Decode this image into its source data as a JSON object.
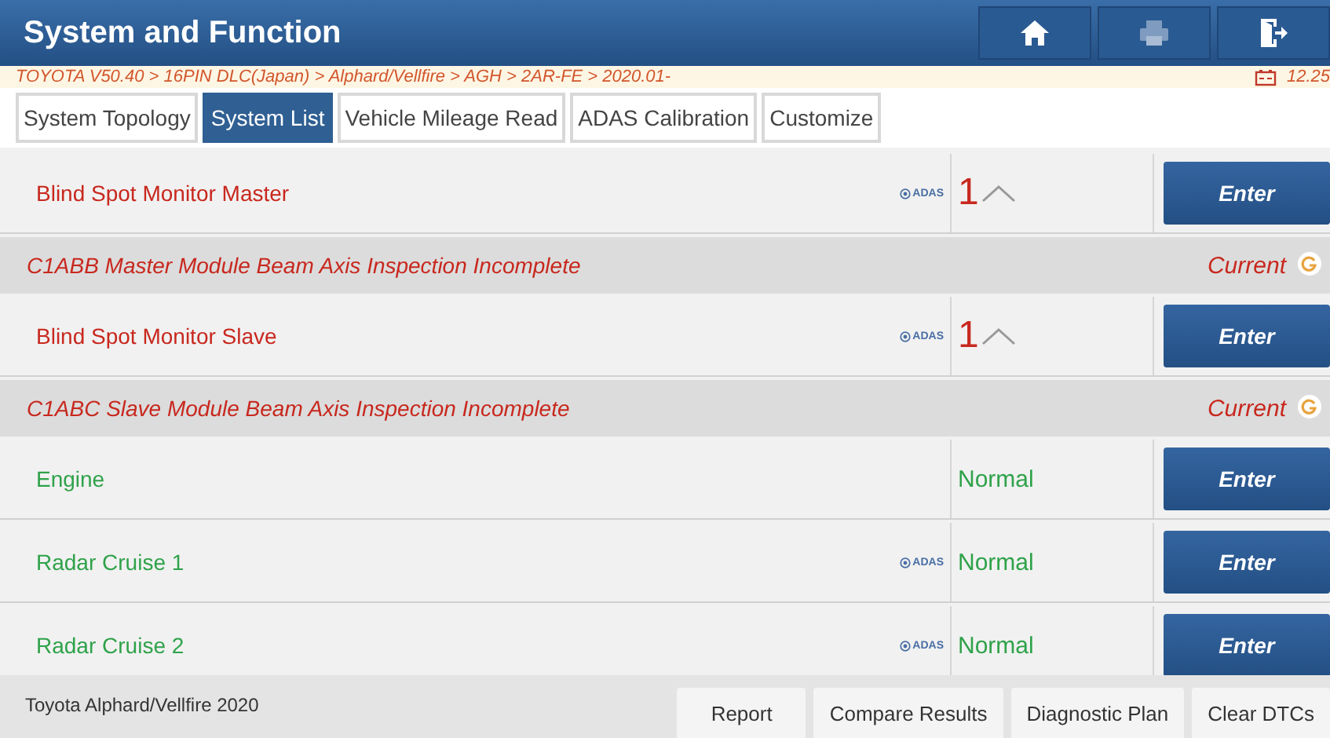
{
  "header": {
    "title": "System and Function"
  },
  "breadcrumb": "TOYOTA V50.40 > 16PIN DLC(Japan) > Alphard/Vellfire > AGH > 2AR-FE > 2020.01-",
  "battery": "12.25",
  "tabs": [
    {
      "label": "System Topology",
      "selected": false
    },
    {
      "label": "System List",
      "selected": true
    },
    {
      "label": "Vehicle Mileage Read",
      "selected": false
    },
    {
      "label": "ADAS Calibration",
      "selected": false
    },
    {
      "label": "Customize",
      "selected": false
    }
  ],
  "rows": [
    {
      "kind": "system",
      "name": "Blind Spot Monitor Master",
      "adas": true,
      "badge": "ADAS",
      "fault": true,
      "status": "1",
      "button": "Enter"
    },
    {
      "kind": "dtc",
      "text": "C1ABB Master Module Beam Axis Inspection Incomplete",
      "status": "Current"
    },
    {
      "kind": "system",
      "name": "Blind Spot Monitor Slave",
      "adas": true,
      "badge": "ADAS",
      "fault": true,
      "status": "1",
      "button": "Enter"
    },
    {
      "kind": "dtc",
      "text": "C1ABC Slave Module Beam Axis Inspection Incomplete",
      "status": "Current"
    },
    {
      "kind": "system",
      "name": "Engine",
      "adas": false,
      "fault": false,
      "status": "Normal",
      "button": "Enter"
    },
    {
      "kind": "system",
      "name": "Radar Cruise 1",
      "adas": true,
      "badge": "ADAS",
      "fault": false,
      "status": "Normal",
      "button": "Enter"
    },
    {
      "kind": "system",
      "name": "Radar Cruise 2",
      "adas": true,
      "badge": "ADAS",
      "fault": false,
      "status": "Normal",
      "button": "Enter"
    }
  ],
  "footer": {
    "vehicle": "Toyota Alphard/Vellfire 2020",
    "buttons": [
      "Report",
      "Compare Results",
      "Diagnostic Plan",
      "Clear DTCs"
    ]
  }
}
